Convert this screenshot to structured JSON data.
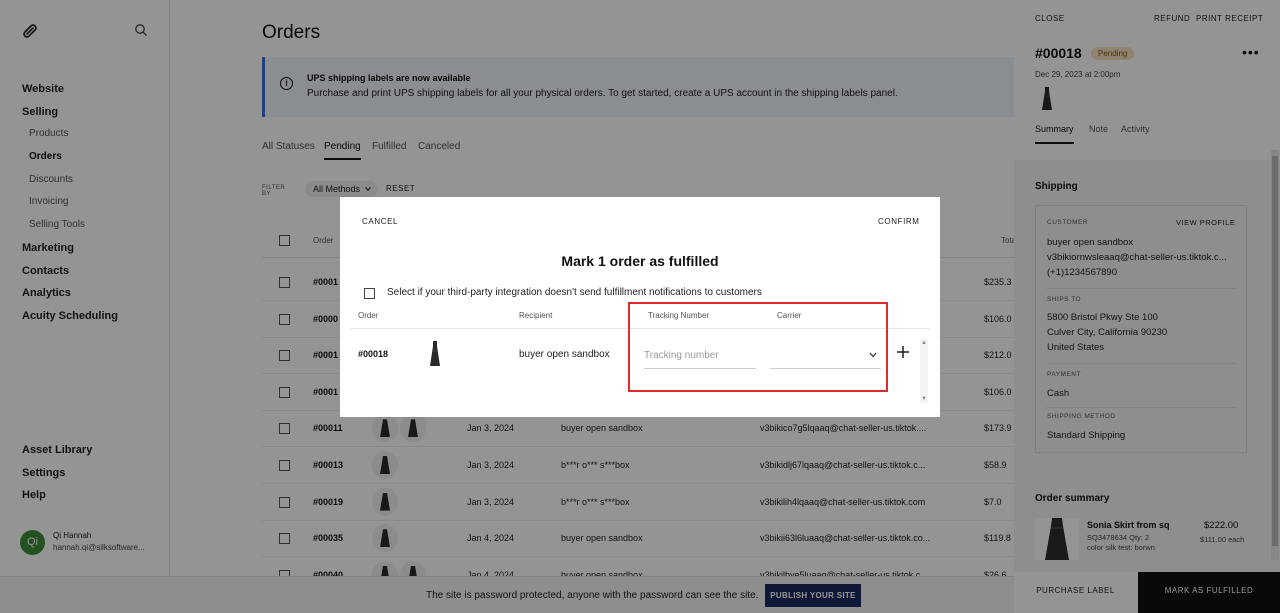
{
  "sidebar": {
    "nav": [
      {
        "label": "Website",
        "type": "item"
      },
      {
        "label": "Selling",
        "type": "item"
      },
      {
        "label": "Products",
        "type": "sub"
      },
      {
        "label": "Orders",
        "type": "sub",
        "active": true
      },
      {
        "label": "Discounts",
        "type": "sub"
      },
      {
        "label": "Invoicing",
        "type": "sub"
      },
      {
        "label": "Selling Tools",
        "type": "sub"
      },
      {
        "label": "Marketing",
        "type": "item"
      },
      {
        "label": "Contacts",
        "type": "item"
      },
      {
        "label": "Analytics",
        "type": "item"
      },
      {
        "label": "Acuity Scheduling",
        "type": "item"
      }
    ],
    "bottom_nav": [
      "Asset Library",
      "Settings",
      "Help"
    ],
    "user": {
      "initials": "Qi",
      "name": "Qi Hannah",
      "email": "hannah.qi@silksoftware..."
    }
  },
  "main": {
    "title": "Orders",
    "banner": {
      "title": "UPS shipping labels are now available",
      "text": "Purchase and print UPS shipping labels for all your physical orders. To get started, create a UPS account in the shipping labels panel."
    },
    "tabs": [
      "All Statuses",
      "Pending",
      "Fulfilled",
      "Canceled"
    ],
    "active_tab": "Pending",
    "filter": {
      "label": "FILTER BY",
      "value": "All Methods",
      "reset": "RESET"
    },
    "table": {
      "headers": {
        "order": "Order",
        "total": "Tota"
      },
      "rows": [
        {
          "order": "#0001",
          "date": "",
          "recipient": "",
          "email": "",
          "total": "$235.3",
          "thumbs": 0
        },
        {
          "order": "#0000",
          "date": "",
          "recipient": "",
          "email": "",
          "total": "$106.0",
          "thumbs": 0
        },
        {
          "order": "#0001",
          "date": "",
          "recipient": "",
          "email": "",
          "total": "$212.0",
          "thumbs": 0
        },
        {
          "order": "#0001",
          "date": "",
          "recipient": "",
          "email": "",
          "total": "$106.0",
          "thumbs": 0
        },
        {
          "order": "#00011",
          "date": "Jan 3, 2024",
          "recipient": "buyer open sandbox",
          "email": "v3bikico7g5lqaaq@chat-seller-us.tiktok....",
          "total": "$173.9",
          "thumbs": 2
        },
        {
          "order": "#00013",
          "date": "Jan 3, 2024",
          "recipient": "b***r o*** s***box",
          "email": "v3bikidlj67lqaaq@chat-seller-us.tiktok.c...",
          "total": "$58.9",
          "thumbs": 1
        },
        {
          "order": "#00019",
          "date": "Jan 3, 2024",
          "recipient": "b***r o*** s***box",
          "email": "v3bikilih4lqaaq@chat-seller-us.tiktok.com",
          "total": "$7.0",
          "thumbs": 1
        },
        {
          "order": "#00035",
          "date": "Jan 4, 2024",
          "recipient": "buyer open sandbox",
          "email": "v3bikii63l6luaaq@chat-seller-us.tiktok.co...",
          "total": "$119.8",
          "thumbs": 1
        },
        {
          "order": "#00040",
          "date": "Jan 4, 2024",
          "recipient": "buyer open sandbox",
          "email": "v3bikilbye5luaaq@chat-seller-us.tiktok.c...",
          "total": "$26.6",
          "thumbs": 2
        }
      ]
    }
  },
  "modal": {
    "cancel": "CANCEL",
    "confirm": "CONFIRM",
    "title": "Mark 1 order as fulfilled",
    "checkbox_label": "Select if your third-party integration doesn't send fulfillment notifications to customers",
    "headers": {
      "order": "Order",
      "recipient": "Recipient",
      "tracking": "Tracking Number",
      "carrier": "Carrier"
    },
    "row": {
      "order": "#00018",
      "recipient": "buyer open sandbox",
      "tracking_value": "",
      "tracking_placeholder": "Tracking number",
      "carrier": ""
    }
  },
  "right_panel": {
    "close": "CLOSE",
    "refund": "REFUND",
    "print_receipt": "PRINT RECEIPT",
    "order_number": "#00018",
    "status": "Pending",
    "date": "Dec 29, 2023 at 2:00pm",
    "tabs": [
      "Summary",
      "Note",
      "Activity"
    ],
    "active_tab": "Summary",
    "shipping": {
      "title": "Shipping",
      "customer_label": "CUSTOMER",
      "view_profile": "VIEW PROFILE",
      "customer_name": "buyer open sandbox",
      "customer_email": "v3bikiornwsleaaq@chat-seller-us.tiktok.c...",
      "customer_phone": "(+1)1234567890",
      "ships_to_label": "SHIPS TO",
      "address_line1": "5800 Bristol Pkwy Ste 100",
      "address_line2": "Culver City, California 90230",
      "address_line3": "United States",
      "payment_label": "PAYMENT",
      "payment_value": "Cash",
      "method_label": "SHIPPING METHOD",
      "method_value": "Standard Shipping"
    },
    "order_summary": {
      "title": "Order summary",
      "item_name": "Sonia Skirt from sq",
      "item_sku": "SQ3478634 Qty: 2",
      "item_desc": "color silk test: borwn",
      "item_price": "$222.00",
      "item_each": "$111.00 each"
    },
    "purchase_label": "PURCHASE LABEL",
    "mark_fulfilled": "MARK AS FULFILLED"
  },
  "password_bar": {
    "text": "The site is password protected, anyone with the password can see the site.",
    "button": "PUBLISH YOUR SITE"
  },
  "colors": {
    "highlight": "#e02b2b",
    "avatar": "#3b8e36",
    "publish_button": "#1a2a5e",
    "pending_badge": "#f4e3c3"
  }
}
